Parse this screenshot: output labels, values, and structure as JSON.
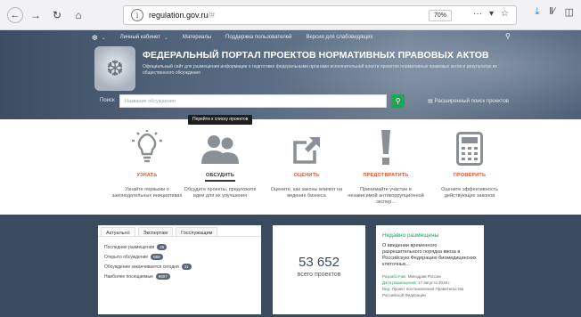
{
  "browser": {
    "url_host": "regulation.gov.ru",
    "url_hash": "/#",
    "zoom": "70%",
    "icons": {
      "back": "back-arrow-icon",
      "forward": "forward-arrow-icon",
      "reload": "reload-icon",
      "home": "home-icon",
      "more": "more-dots-icon",
      "pocket": "pocket-icon",
      "star": "star-icon",
      "download": "download-icon",
      "library": "library-icon",
      "sidebar": "sidebar-icon"
    }
  },
  "topnav": {
    "items": [
      "Личный кабинет",
      "Материалы",
      "Поддержка пользователей",
      "Версия для слабовидящих"
    ]
  },
  "hero": {
    "title": "ФЕДЕРАЛЬНЫЙ ПОРТАЛ ПРОЕКТОВ НОРМАТИВНЫХ ПРАВОВЫХ АКТОВ",
    "subtitle": "Официальный сайт для размещения информации о подготовке федеральными органами исполнительной власти проектов нормативных правовых актов и результатах их общественного обсуждения",
    "search_label": "Поиск",
    "search_placeholder": "Название обсуждения",
    "advanced_search": "Расширенный поиск проектов"
  },
  "tooltip": "Перейти к списку проектов",
  "features": [
    {
      "label": "УЗНАТЬ",
      "desc": "Узнайте первыми о законодательных инициативах",
      "icon": "lightbulb-icon"
    },
    {
      "label": "ОБСУДИТЬ",
      "desc": "Обсудите проекты, предложите идеи для их улучшения",
      "icon": "people-icon"
    },
    {
      "label": "ОЦЕНИТЬ",
      "desc": "Оцените, как законы влияют на ведение бизнеса",
      "icon": "arrow-box-icon"
    },
    {
      "label": "ПРЕДОТВРАТИТЬ",
      "desc": "Принимайте участие в независимой антикоррупционной экспер...",
      "icon": "exclamation-icon"
    },
    {
      "label": "ПРОВЕРИТЬ",
      "desc": "Оцените эффективность действующих законов",
      "icon": "calculator-icon"
    }
  ],
  "stats_card": {
    "tabs": [
      "Актуально",
      "Экспертам",
      "Госслужащим"
    ],
    "rows": [
      {
        "label": "Последние размещения",
        "badge": "45"
      },
      {
        "label": "Открыто обсуждение",
        "badge": "668"
      },
      {
        "label": "Обсуждение заканчивается сегодня",
        "badge": "31"
      },
      {
        "label": "Наиболее посещаемые",
        "badge": "8687"
      }
    ]
  },
  "total": {
    "number": "53 652",
    "caption": "всего проектов"
  },
  "recent": {
    "heading": "Недавно размещены",
    "text": "О введении временного разрешительного порядка ввоза в Российскую Федерацию биомедицинских клеточных...",
    "dev_key": "Разработчик:",
    "dev_val": "Минздрав России",
    "date_key": "Дата размещения:",
    "date_val": "17 августа 2018 г.",
    "type_key": "Вид:",
    "type_val": "Проект постановления Правительства Российской Федерации"
  }
}
